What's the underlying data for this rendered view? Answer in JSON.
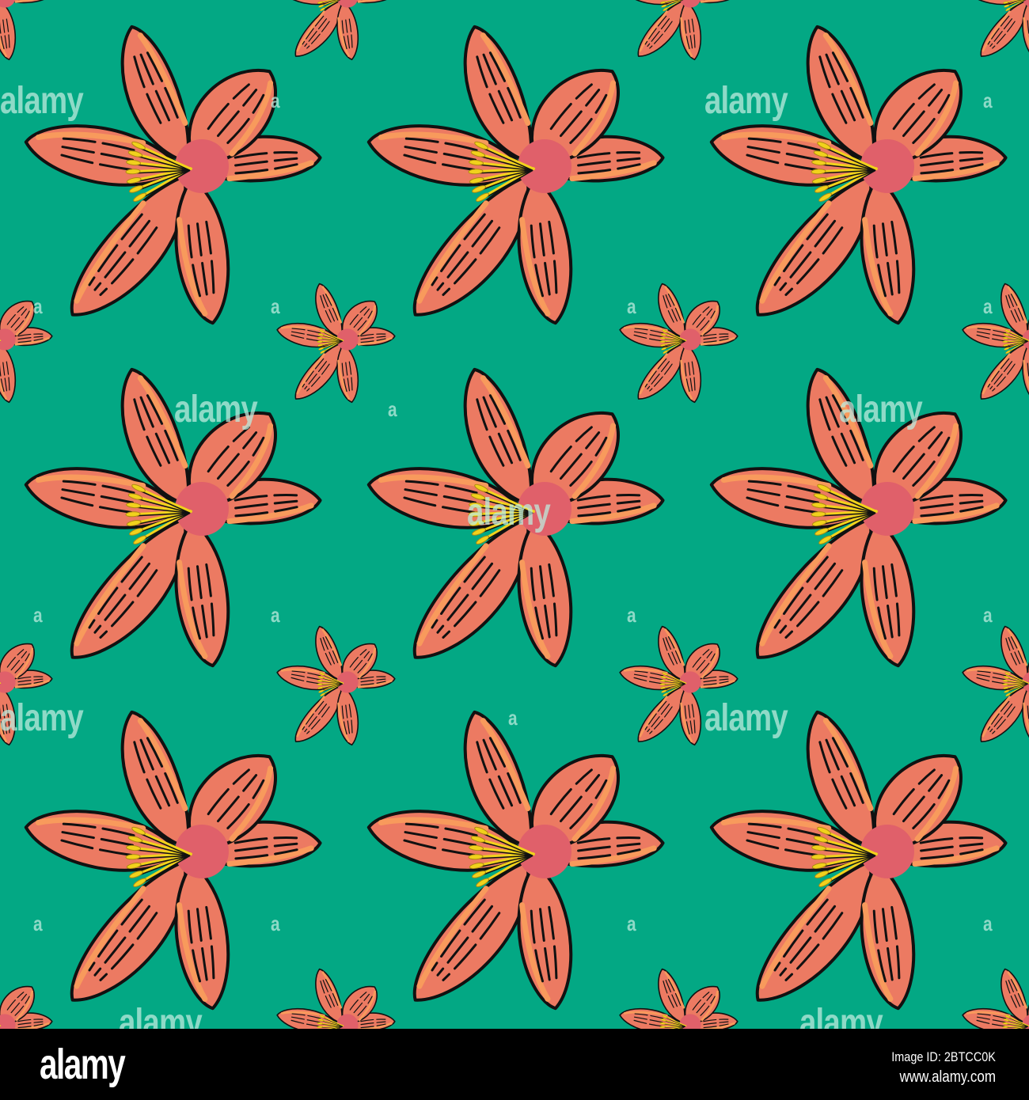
{
  "colors": {
    "background": "#03a884",
    "petal": "#ec7a62",
    "petal_highlight": "#f89a5c",
    "petal_shadow": "#e0606a",
    "stamen": "#f1d21c",
    "outline": "#111111"
  },
  "pattern": {
    "subject": "lily-flower",
    "watermark_text": "alamy",
    "watermark_mark": "a"
  },
  "footer": {
    "logo": "alamy",
    "image_id": "Image ID: 2BTCC0K",
    "url": "www.alamy.com"
  }
}
